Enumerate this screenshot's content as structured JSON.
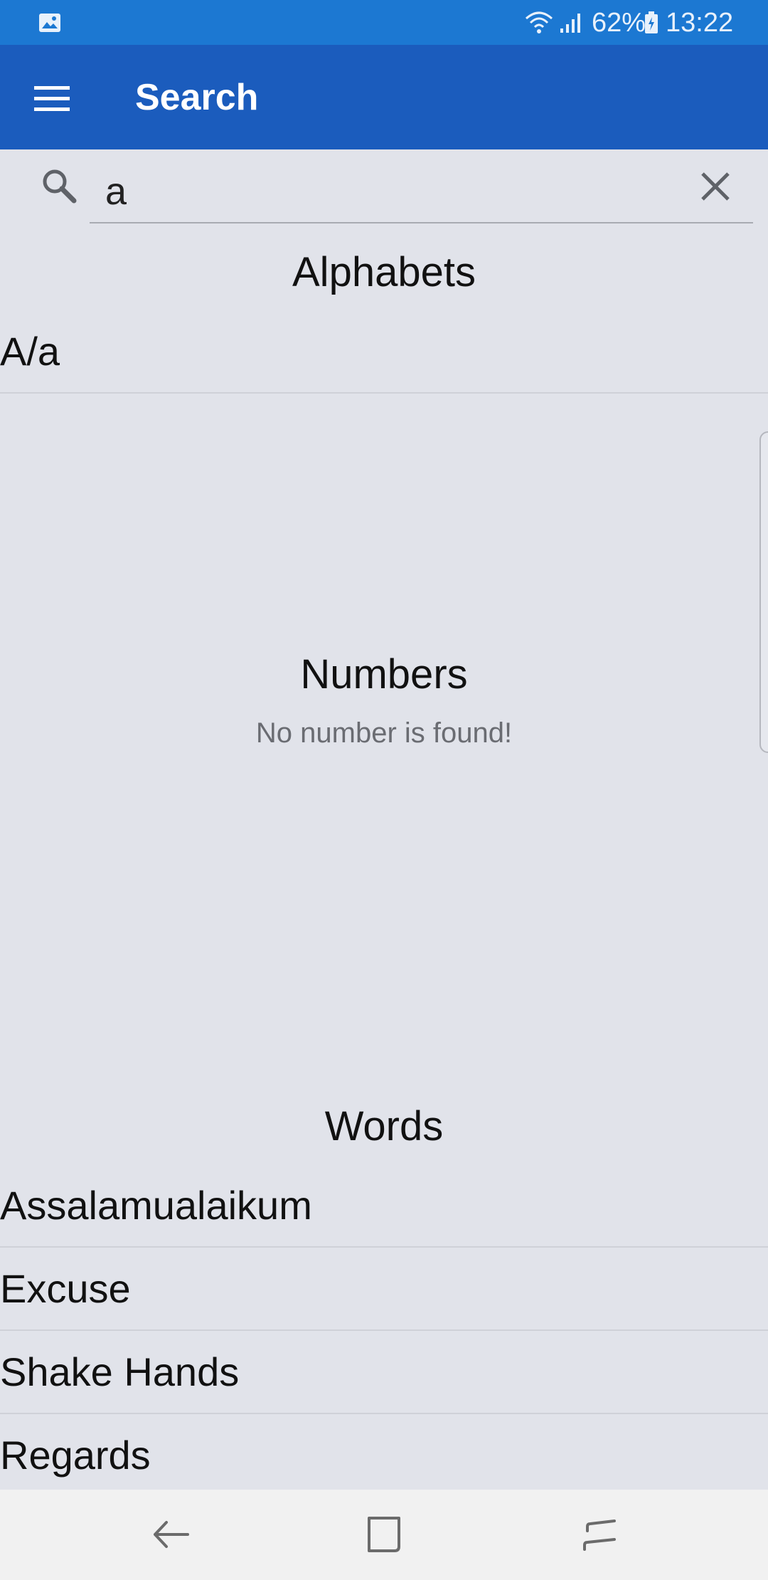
{
  "status_bar": {
    "battery_percent": "62%",
    "time": "13:22"
  },
  "app_bar": {
    "title": "Search"
  },
  "search": {
    "value": "a"
  },
  "sections": {
    "alphabets": {
      "heading": "Alphabets",
      "items": [
        "A/a"
      ]
    },
    "numbers": {
      "heading": "Numbers",
      "empty_message": "No number is found!"
    },
    "words": {
      "heading": "Words",
      "items": [
        "Assalamualaikum",
        "Excuse",
        "Shake Hands",
        "Regards"
      ]
    }
  },
  "colors": {
    "status_bar": "#1c78d2",
    "app_bar": "#1b5cbd",
    "background": "#e1e3ea",
    "nav_bar": "#f1f1f1"
  },
  "icons": [
    "gallery-icon",
    "wifi-icon",
    "signal-icon",
    "battery-icon",
    "menu-icon",
    "search-icon",
    "close-icon",
    "back-icon",
    "home-icon",
    "recents-icon"
  ]
}
